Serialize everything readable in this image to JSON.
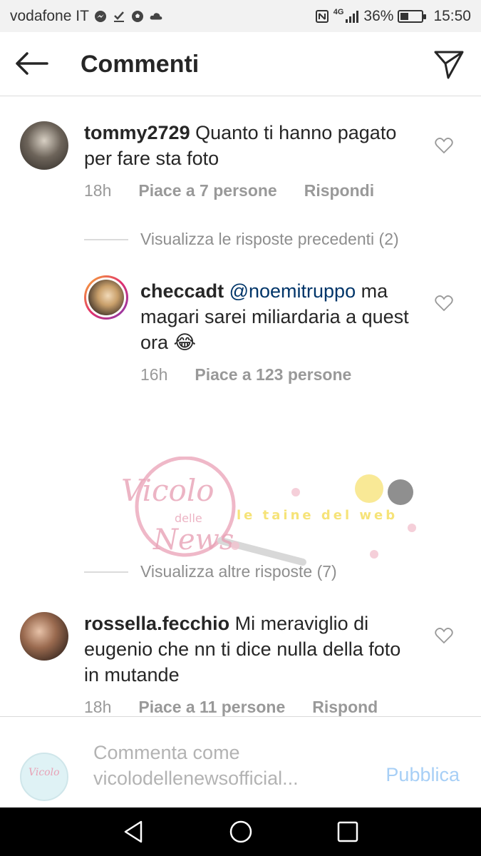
{
  "status_bar": {
    "carrier": "vodafone IT",
    "network": "4G",
    "battery": "36%",
    "battery_level": 0.36,
    "time": "15:50"
  },
  "header": {
    "title": "Commenti"
  },
  "comments": [
    {
      "username": "tommy2729",
      "text": "Quanto ti hanno pagato per fare sta foto",
      "time": "18h",
      "likes": "Piace a 7 persone",
      "reply": "Rispondi"
    },
    {
      "username": "rossella.fecchio",
      "text": "Mi meraviglio di eugenio che nn ti dice nulla della foto in mutande",
      "time": "18h",
      "likes": "Piace a 11 persone",
      "reply": "Rispond"
    }
  ],
  "replies": {
    "view_previous": "Visualizza le risposte precedenti (2)",
    "view_more": "Visualizza altre risposte (7)",
    "reply": {
      "username": "checcadt",
      "mention": "@noemitruppo",
      "text": "ma magari sarei miliardaria a quest ora",
      "emoji": "😂",
      "time": "16h",
      "likes": "Piace a 123 persone"
    }
  },
  "watermark": {
    "brand_line1": "Vicolo",
    "brand_line2": "delle",
    "brand_line3": "News",
    "tagline": "le taine del web"
  },
  "composer": {
    "placeholder_line1": "Commenta come",
    "placeholder_line2": "vicolodellenewsofficial...",
    "publish": "Pubblica"
  },
  "colors": {
    "link": "#003569",
    "publish_disabled": "#a7cff6",
    "meta": "#999999"
  }
}
